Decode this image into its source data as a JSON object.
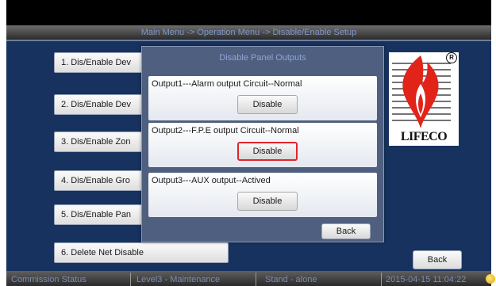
{
  "header": {
    "breadcrumb": "Main Menu -> Operation Menu -> Disable/Enable Setup"
  },
  "menu": {
    "items": [
      {
        "label": "1. Dis/Enable Dev"
      },
      {
        "label": "2. Dis/Enable Dev"
      },
      {
        "label": "3. Dis/Enable Zon"
      },
      {
        "label": "4. Dis/Enable Gro"
      },
      {
        "label": "5. Dis/Enable Pan"
      },
      {
        "label": "6. Delete Net Disable"
      }
    ],
    "back_label": "Back"
  },
  "logo": {
    "text": "LIFECO",
    "registered": "R"
  },
  "dialog": {
    "title": "Disable Panel Outputs",
    "outputs": [
      {
        "label": "Output1---Alarm output Circuit--Normal",
        "button": "Disable"
      },
      {
        "label": "Output2---F.P.E output Circuit--Normal",
        "button": "Disable"
      },
      {
        "label": "Output3---AUX output--Actived",
        "button": "Disable"
      }
    ],
    "back_label": "Back"
  },
  "status": {
    "commission": "Commission Status",
    "level": "Level3 - Maintenance",
    "mode": "Stand - alone",
    "datetime": "2015-04-15 11:04:22"
  },
  "colors": {
    "screen_bg": "#17325f",
    "dialog_bg": "#4f5f7f",
    "focus_border": "#e1252b",
    "logo_red": "#e2231a"
  }
}
